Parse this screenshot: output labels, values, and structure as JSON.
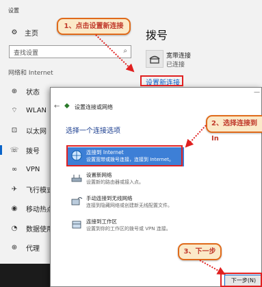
{
  "settings": {
    "window_title": "设置",
    "home": "主页",
    "search_placeholder": "查找设置",
    "section_header": "网络和 Internet",
    "nav": [
      {
        "label": "状态",
        "icon": "status-icon"
      },
      {
        "label": "WLAN",
        "icon": "wifi-icon"
      },
      {
        "label": "以太网",
        "icon": "ethernet-icon"
      },
      {
        "label": "拨号",
        "icon": "dialup-icon"
      },
      {
        "label": "VPN",
        "icon": "vpn-icon"
      },
      {
        "label": "飞行模式",
        "icon": "airplane-icon"
      },
      {
        "label": "移动热点",
        "icon": "hotspot-icon"
      },
      {
        "label": "数据使用量",
        "icon": "data-usage-icon"
      },
      {
        "label": "代理",
        "icon": "proxy-icon"
      }
    ],
    "active_nav": "拨号"
  },
  "content": {
    "title": "拨号",
    "connection_name": "宽带连接",
    "connection_status": "已连接",
    "setup_link": "设置新连接"
  },
  "dialog": {
    "title": "设置连接或网络",
    "heading": "选择一个连接选项",
    "options": [
      {
        "title": "连接到 Internet",
        "desc": "设置宽带或拨号连接，连接到 Internet。",
        "selected": true
      },
      {
        "title": "设置新网络",
        "desc": "设置新的路由器或接入点。",
        "selected": false
      },
      {
        "title": "手动连接到无线网络",
        "desc": "连接到隐藏网络或创建新无线配置文件。",
        "selected": false
      },
      {
        "title": "连接到工作区",
        "desc": "设置到你的工作区的拨号或 VPN 连接。",
        "selected": false
      }
    ],
    "next_button": "下一步(N)"
  },
  "annotations": {
    "step1": "1、点击设置新连接",
    "step2": "2、选择连接到 In",
    "step3": "3、下一步"
  },
  "colors": {
    "accent": "#0a64c8",
    "callout_border": "#e06a1a",
    "callout_fill": "#fbe9c8",
    "highlight": "#e02020",
    "selected_option": "#3d7fd6"
  }
}
